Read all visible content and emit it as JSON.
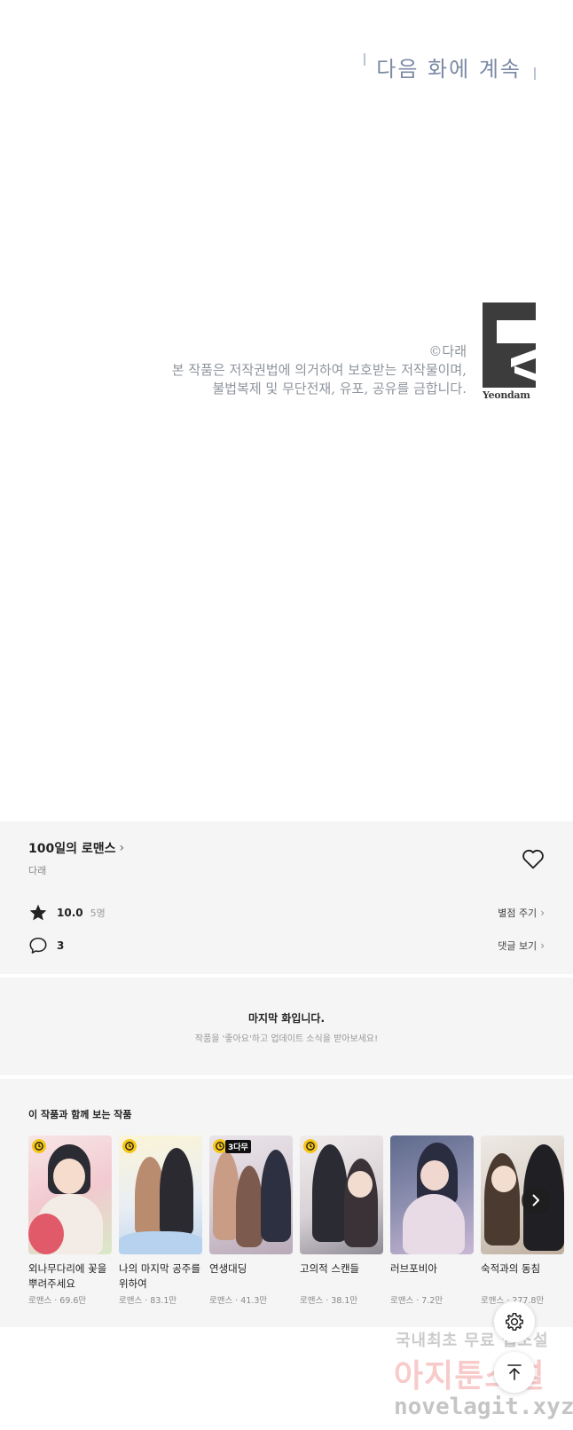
{
  "panel": {
    "next_episode_text": "다음 화에 계속",
    "copyright_line1": "©다래",
    "copyright_line2": "본 작품은 저작권법에 의거하여 보호받는 저작물이며,",
    "copyright_line3": "불법복제 및 무단전재, 유포, 공유를 금합니다.",
    "publisher_logo_text": "Yeondam"
  },
  "work": {
    "title": "100일의 로맨스",
    "author": "다래",
    "rating": "10.0",
    "rating_count": "5명",
    "rate_link": "별점 주기",
    "comment_count": "3",
    "comments_link": "댓글 보기"
  },
  "last_episode": {
    "title": "마지막 화입니다.",
    "subtitle": "작품을 '좋아요'하고 업데이트 소식을 받아보세요!"
  },
  "recommendations": {
    "heading": "이 작품과 함께 보는 작품",
    "items": [
      {
        "name": "외나무다리에 꽃을 뿌려주세요",
        "meta": "로맨스 · 69.6만",
        "badge": "clock-icon"
      },
      {
        "name": "나의 마지막 공주를 위하여",
        "meta": "로맨스 · 83.1만",
        "badge": "clock-icon"
      },
      {
        "name": "연생대딩",
        "meta": "로맨스 · 41.3만",
        "badge": "clock-icon",
        "badge_text": "3다무"
      },
      {
        "name": "고의적 스캔들",
        "meta": "로맨스 · 38.1만",
        "badge": "clock-icon"
      },
      {
        "name": "러브포비아",
        "meta": "로맨스 · 7.2만",
        "badge": ""
      },
      {
        "name": "숙적과의 동침",
        "meta": "로맨스 · 277.8만",
        "badge": ""
      }
    ]
  },
  "watermark": {
    "line1": "국내최초 무료 웹소설",
    "line2": "아지툰소설",
    "line3": "novelagit.xyz"
  },
  "colors": {
    "section_bg": "#f5f5f5",
    "next_episode": "#7c8aa6",
    "badge": "#f5c518"
  }
}
